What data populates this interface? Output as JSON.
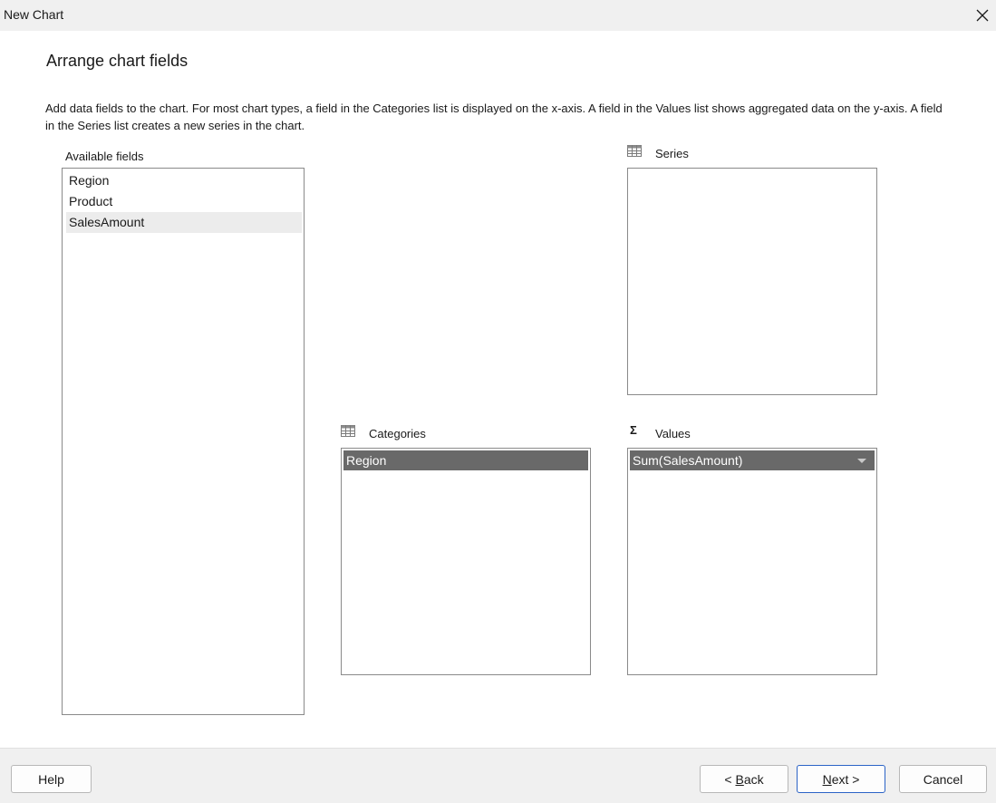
{
  "window": {
    "title": "New Chart"
  },
  "page": {
    "heading": "Arrange chart fields",
    "description": "Add data fields to the chart. For most chart types, a field in the Categories list is displayed on the x-axis. A field in the Values list shows aggregated data on the y-axis. A field in the Series list creates a new series in the chart."
  },
  "available_fields": {
    "label": "Available fields",
    "items": [
      "Region",
      "Product",
      "SalesAmount"
    ]
  },
  "series": {
    "label": "Series",
    "icon": "table-icon",
    "items": []
  },
  "categories": {
    "label": "Categories",
    "icon": "table-icon",
    "items": [
      "Region"
    ]
  },
  "values": {
    "label": "Values",
    "icon": "sigma-icon",
    "icon_glyph": "Σ",
    "items": [
      "Sum(SalesAmount)"
    ]
  },
  "buttons": {
    "help": "Help",
    "back_prefix": "< ",
    "back_mnemonic": "B",
    "back_rest": "ack",
    "next_mnemonic": "N",
    "next_rest": "ext >",
    "cancel": "Cancel"
  },
  "colors": {
    "selected_field_bg": "#696969",
    "hover_row_bg": "#ececec",
    "default_button_border": "#2b63c6",
    "chrome_bg": "#f0f0f0"
  }
}
